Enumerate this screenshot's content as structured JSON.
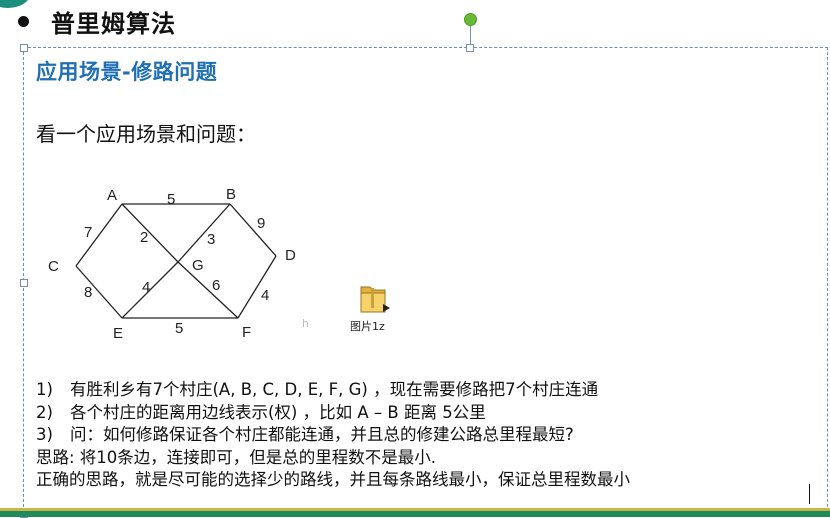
{
  "slide": {
    "title": "普里姆算法",
    "subtitle": "应用场景-修路问题",
    "intro": "看一个应用场景和问题：",
    "graph": {
      "nodes": [
        "A",
        "B",
        "C",
        "D",
        "E",
        "F",
        "G"
      ],
      "edges": [
        {
          "from": "A",
          "to": "B",
          "weight": "5"
        },
        {
          "from": "A",
          "to": "C",
          "weight": "7"
        },
        {
          "from": "A",
          "to": "G",
          "weight": "2"
        },
        {
          "from": "B",
          "to": "G",
          "weight": "3"
        },
        {
          "from": "B",
          "to": "D",
          "weight": "9"
        },
        {
          "from": "C",
          "to": "E",
          "weight": "8"
        },
        {
          "from": "E",
          "to": "G",
          "weight": "4"
        },
        {
          "from": "G",
          "to": "F",
          "weight": "6"
        },
        {
          "from": "D",
          "to": "F",
          "weight": "4"
        },
        {
          "from": "E",
          "to": "F",
          "weight": "5"
        }
      ]
    },
    "file": {
      "label": "图片1z",
      "icon": "folder-icon"
    },
    "stray_char": "h",
    "problems": [
      {
        "num": "1)",
        "text": "有胜利乡有7个村庄(A, B, C, D, E, F, G) ，现在需要修路把7个村庄连通"
      },
      {
        "num": "2)",
        "text": "各个村庄的距离用边线表示(权) ，比如 A – B 距离 5公里"
      },
      {
        "num": "3)",
        "text": "问：如何修路保证各个村庄都能连通，并且总的修建公路总里程最短?"
      }
    ],
    "idea": "思路: 将10条边，连接即可，但是总的里程数不是最小.",
    "correct_idea": "正确的思路，就是尽可能的选择少的路线，并且每条路线最小，保证总里程数最小"
  },
  "colors": {
    "subtitle": "#1f6fb5",
    "accent": "#1f8a5a",
    "rotate_handle": "#66bb33"
  }
}
